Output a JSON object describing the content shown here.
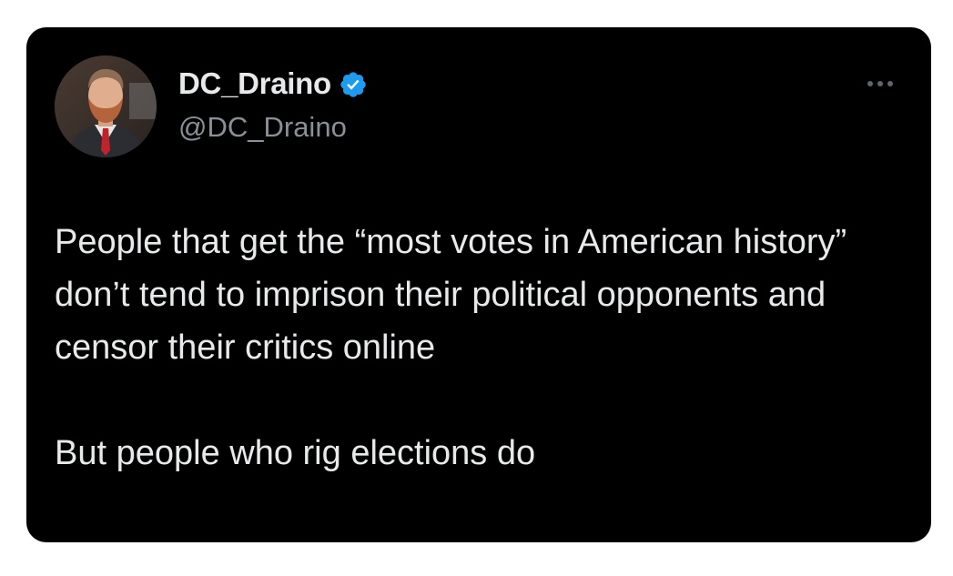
{
  "tweet": {
    "author": {
      "display_name": "DC_Draino",
      "handle": "@DC_Draino",
      "verified": true,
      "verified_icon": "verified-badge-icon",
      "avatar": "profile-photo"
    },
    "more_icon": "more-options-icon",
    "paragraphs": [
      "People that get the “most votes in American history” don’t tend to imprison their political opponents and censor their critics online",
      "But people who rig elections do"
    ]
  },
  "colors": {
    "card_background": "#000000",
    "text_primary": "#e7e9ea",
    "text_secondary": "#8b9096",
    "verified_blue": "#1d9bf0"
  }
}
